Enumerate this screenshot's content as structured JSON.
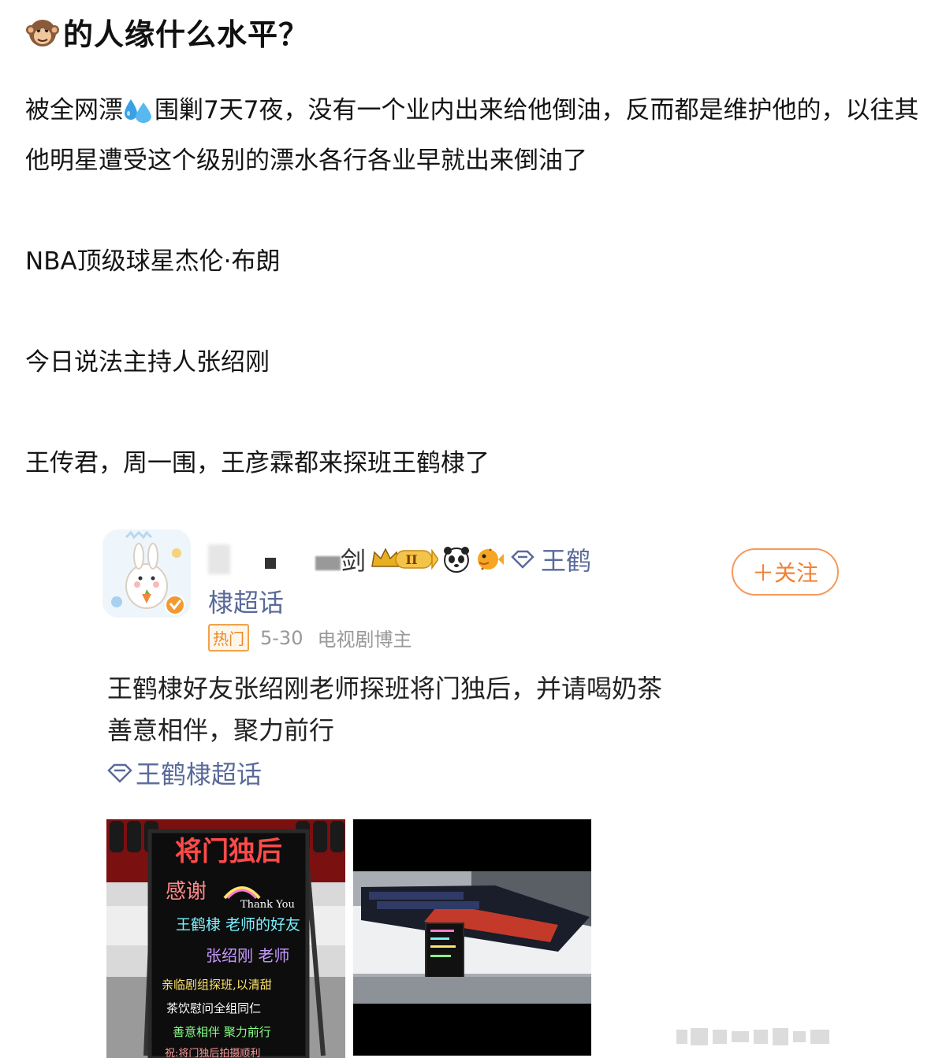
{
  "question": {
    "emoji": "monkey-icon",
    "title": "的人缘什么水平？"
  },
  "body": {
    "p1_before": "被全网漂",
    "p1_emoji": "sweat-droplets-icon",
    "p1_after": "围剿7天7夜，没有一个业内出来给他倒油，反而都是维护他的，以往其他明星遭受这个级别的漂水各行各业早就出来倒油了",
    "p2": "NBA顶级球星杰伦·布朗",
    "p3": "今日说法主持人张绍刚",
    "p4": "王传君，周一围，王彦霖都来探班王鹤棣了"
  },
  "embed": {
    "username_visible": "剑",
    "badge_level": "II",
    "supertopic_name_part1": "王鹤",
    "supertopic_name_part2": "棣超话",
    "follow_label": "＋关注",
    "hot_tag": "热门",
    "date": "5-30",
    "user_type": "电视剧博主",
    "post_line1": "王鹤棣好友张绍刚老师探班将门独后，并请喝奶茶",
    "post_line2": "善意相伴，聚力前行",
    "topic_link": "王鹤棣超话",
    "sign_title": "将门独后",
    "sign_line1": "感谢",
    "sign_line2": "王鹤棣 老师的好友",
    "sign_line3": "张绍刚 老师",
    "sign_line4": "亲临剧组探班,以清甜",
    "sign_line5": "茶饮慰问全组同仁",
    "sign_line6": "善意相伴 聚力前行",
    "sign_line7": "祝:将门独后拍摄顺利",
    "sign_thanks": "Thank You",
    "colors": {
      "follow": "#f27f34",
      "link": "#5a6a9a",
      "hot": "#e8892b"
    }
  }
}
